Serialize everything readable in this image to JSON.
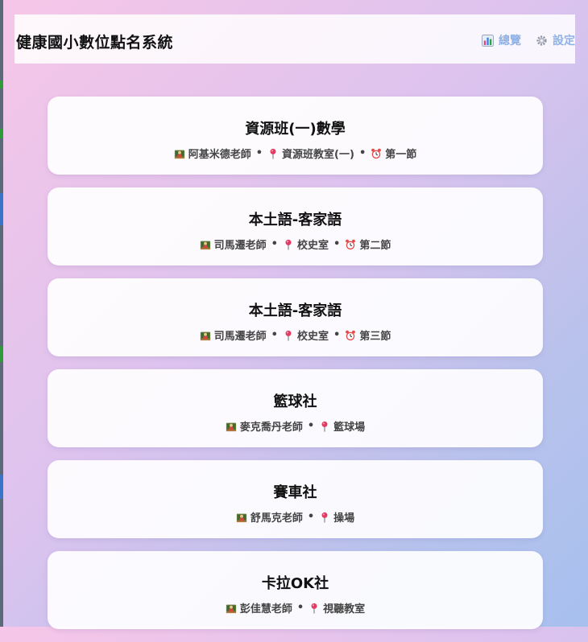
{
  "app": {
    "title": "健康國小數位點名系統"
  },
  "nav": {
    "overview_label": "總覽",
    "settings_label": "設定"
  },
  "separator": "•",
  "courses": [
    {
      "name": "資源班(一)數學",
      "teacher": "阿基米德老師",
      "location": "資源班教室(一)",
      "period": "第一節"
    },
    {
      "name": "本土語-客家語",
      "teacher": "司馬遷老師",
      "location": "校史室",
      "period": "第二節"
    },
    {
      "name": "本土語-客家語",
      "teacher": "司馬遷老師",
      "location": "校史室",
      "period": "第三節"
    },
    {
      "name": "籃球社",
      "teacher": "麥克喬丹老師",
      "location": "籃球場"
    },
    {
      "name": "賽車社",
      "teacher": "舒馬克老師",
      "location": "操場"
    },
    {
      "name": "卡拉OK社",
      "teacher": "彭佳慧老師",
      "location": "視聽教室"
    }
  ],
  "icons": {
    "overview": "bar-chart-icon",
    "settings": "gear-icon",
    "teacher": "teacher-icon",
    "location": "pin-icon",
    "period": "alarm-clock-icon"
  }
}
